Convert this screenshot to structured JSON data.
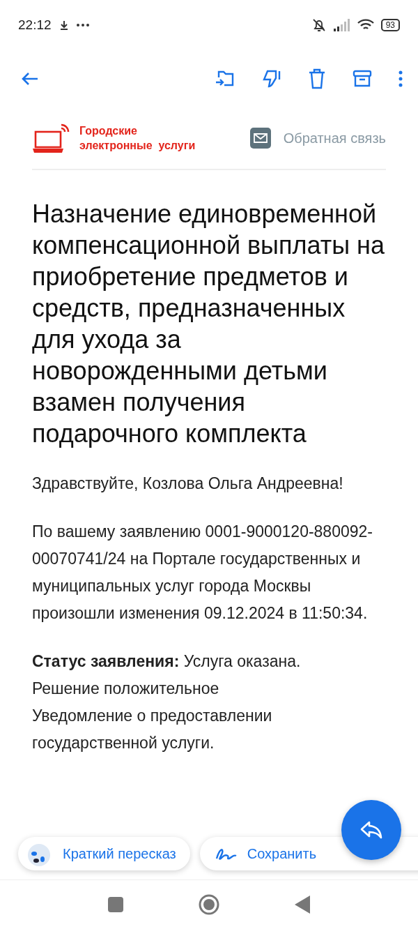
{
  "status_bar": {
    "time": "22:12",
    "battery": "93"
  },
  "sender": {
    "brand_line1": "Городские",
    "brand_line2": "электронные  услуги",
    "feedback": "Обратная связь"
  },
  "title": "Назначение единовременной компенсационной выплаты на приобретение предметов и средств, предназначенных для ухода за новорожденными детьми взамен получения подарочного комплекта",
  "greeting": "Здравствуйте, Козлова Ольга Андреевна!",
  "paragraph": "По вашему заявлению 0001-9000120-880092-00070741/24 на Портале государственных и муниципальных услуг города Москвы произошли изменения 09.12.2024 в 11:50:34.",
  "status_lines": [
    "**Статус заявления:** Услуга оказана.",
    "Решение положительное",
    "Уведомление о предоставлении государственной услуги."
  ],
  "chips": [
    {
      "kind": "summary",
      "label": "Краткий пересказ"
    },
    {
      "kind": "note",
      "label": "Сохранить"
    }
  ]
}
